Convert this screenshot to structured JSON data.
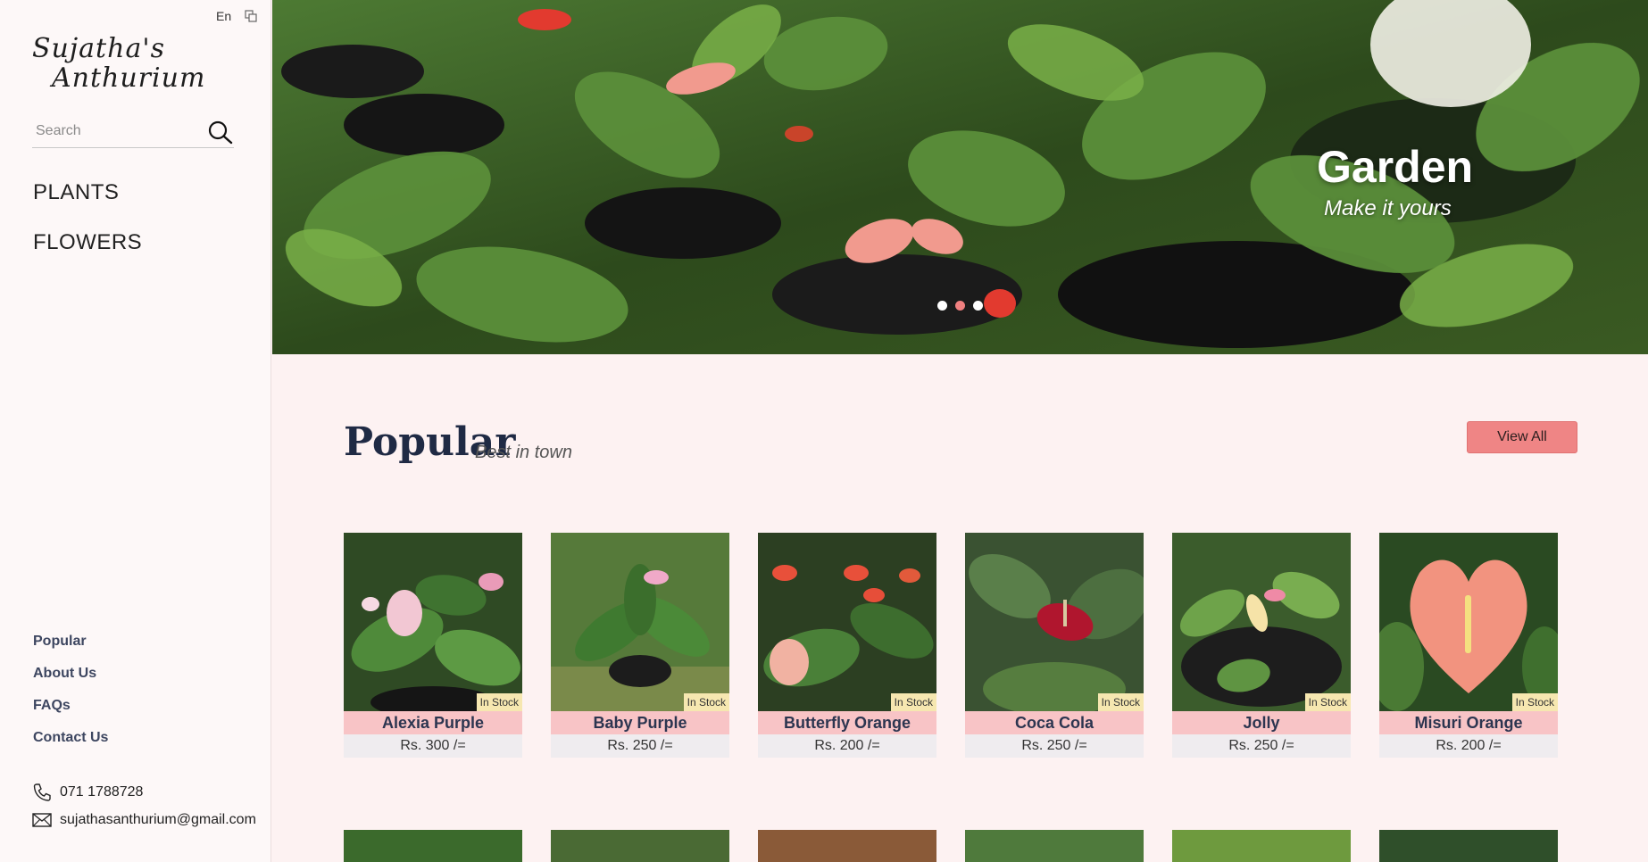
{
  "language": {
    "label": "En",
    "icon": "translate-icon"
  },
  "brand": {
    "line1": "Sujatha's",
    "line2": "Anthurium"
  },
  "search": {
    "placeholder": "Search",
    "icon": "search-icon"
  },
  "nav": {
    "items": [
      "PLANTS",
      "FLOWERS"
    ]
  },
  "footer_nav": {
    "items": [
      "Popular",
      "About Us",
      "FAQs",
      "Contact Us"
    ]
  },
  "contact": {
    "phone": "071 1788728",
    "email": "sujathasanthurium@gmail.com",
    "phone_icon": "phone-icon",
    "email_icon": "mail-icon"
  },
  "hero": {
    "title": "Garden",
    "subtitle": "Make it yours",
    "slides": 3,
    "active_slide": 2
  },
  "popular": {
    "title": "Popular",
    "subtitle": "Best in town",
    "view_all": "View All"
  },
  "products": [
    {
      "name": "Alexia Purple",
      "price": "Rs. 300 /=",
      "stock": "In Stock"
    },
    {
      "name": "Baby Purple",
      "price": "Rs. 250 /=",
      "stock": "In Stock"
    },
    {
      "name": "Butterfly Orange",
      "price": "Rs. 200 /=",
      "stock": "In Stock"
    },
    {
      "name": "Coca Cola",
      "price": "Rs. 250 /=",
      "stock": "In Stock"
    },
    {
      "name": "Jolly",
      "price": "Rs. 250 /=",
      "stock": "In Stock"
    },
    {
      "name": "Misuri Orange",
      "price": "Rs. 200 /=",
      "stock": "In Stock"
    }
  ],
  "colors": {
    "accent": "#ef8585",
    "name_bg": "#f8c4c6",
    "badge_bg": "#f6e7b0",
    "page_bg": "#fdf2f2"
  }
}
